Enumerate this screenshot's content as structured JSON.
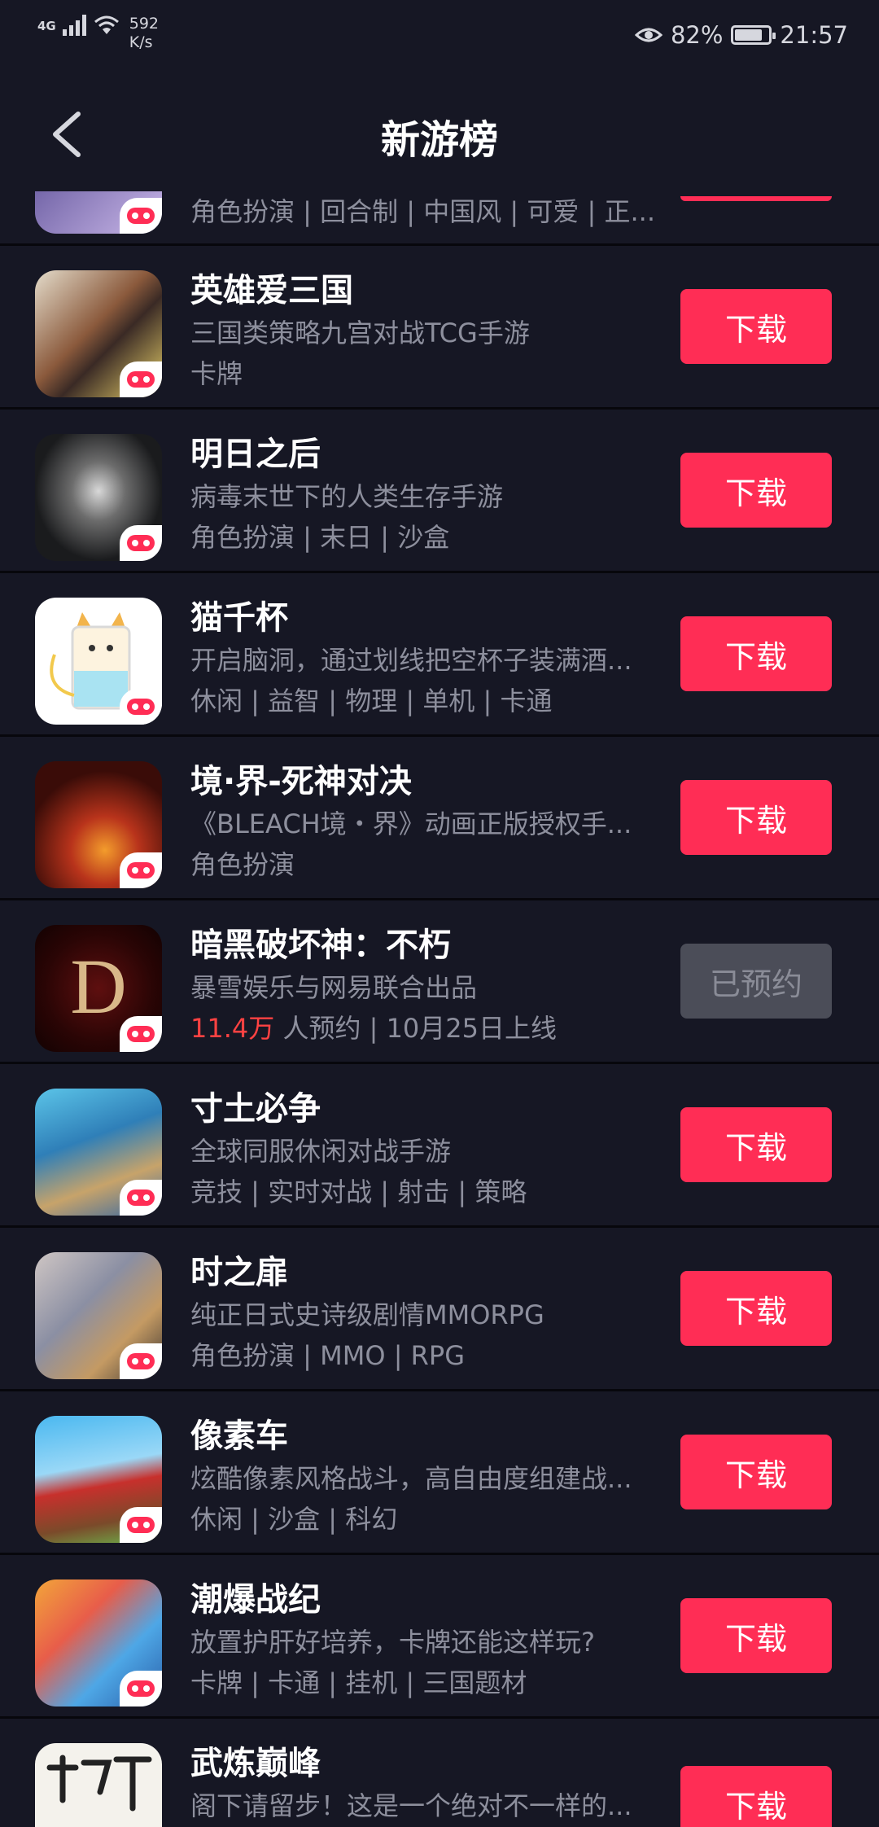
{
  "status_bar": {
    "network": "4G",
    "speed_value": "592",
    "speed_unit": "K/s",
    "battery_percent": "82%",
    "battery_level": 0.82,
    "time": "21:57"
  },
  "header": {
    "title": "新游榜"
  },
  "partial_item": {
    "tags": "角色扮演 | 回合制 | 中国风 | 可爱 | 正..."
  },
  "games": [
    {
      "name": "英雄爱三国",
      "desc": "三国类策略九宫对战TCG手游",
      "tags": "卡牌",
      "button": "下载"
    },
    {
      "name": "明日之后",
      "desc": "病毒末世下的人类生存手游",
      "tags": "角色扮演 | 末日 | 沙盒",
      "button": "下载"
    },
    {
      "name": "猫千杯",
      "desc": "开启脑洞，通过划线把空杯子装满酒...",
      "tags": "休闲 | 益智 | 物理 | 单机 | 卡通",
      "button": "下载"
    },
    {
      "name": "境·界-死神对决",
      "desc": "《BLEACH境・界》动画正版授权手...",
      "tags": "角色扮演",
      "button": "下载"
    },
    {
      "name": "暗黑破坏神：不朽",
      "desc": "暴雪娱乐与网易联合出品",
      "reserve_count": "11.4万",
      "reserve_rest": " 人预约 | 10月25日上线",
      "button": "已预约"
    },
    {
      "name": "寸土必争",
      "desc": "全球同服休闲对战手游",
      "tags": "竞技 | 实时对战 | 射击 | 策略",
      "button": "下载"
    },
    {
      "name": "时之扉",
      "desc": "纯正日式史诗级剧情MMORPG",
      "tags": "角色扮演 | MMO | RPG",
      "button": "下载"
    },
    {
      "name": "像素车",
      "desc": "炫酷像素风格战斗，高自由度组建战...",
      "tags": "休闲 | 沙盒 | 科幻",
      "button": "下载"
    },
    {
      "name": "潮爆战纪",
      "desc": "放置护肝好培养，卡牌还能这样玩?",
      "tags": "卡牌 | 卡通 | 挂机 | 三国题材",
      "button": "下载"
    },
    {
      "name": "武炼巅峰",
      "desc": "阁下请留步！这是一个绝对不一样的...",
      "tags": "",
      "button": "下载"
    }
  ]
}
